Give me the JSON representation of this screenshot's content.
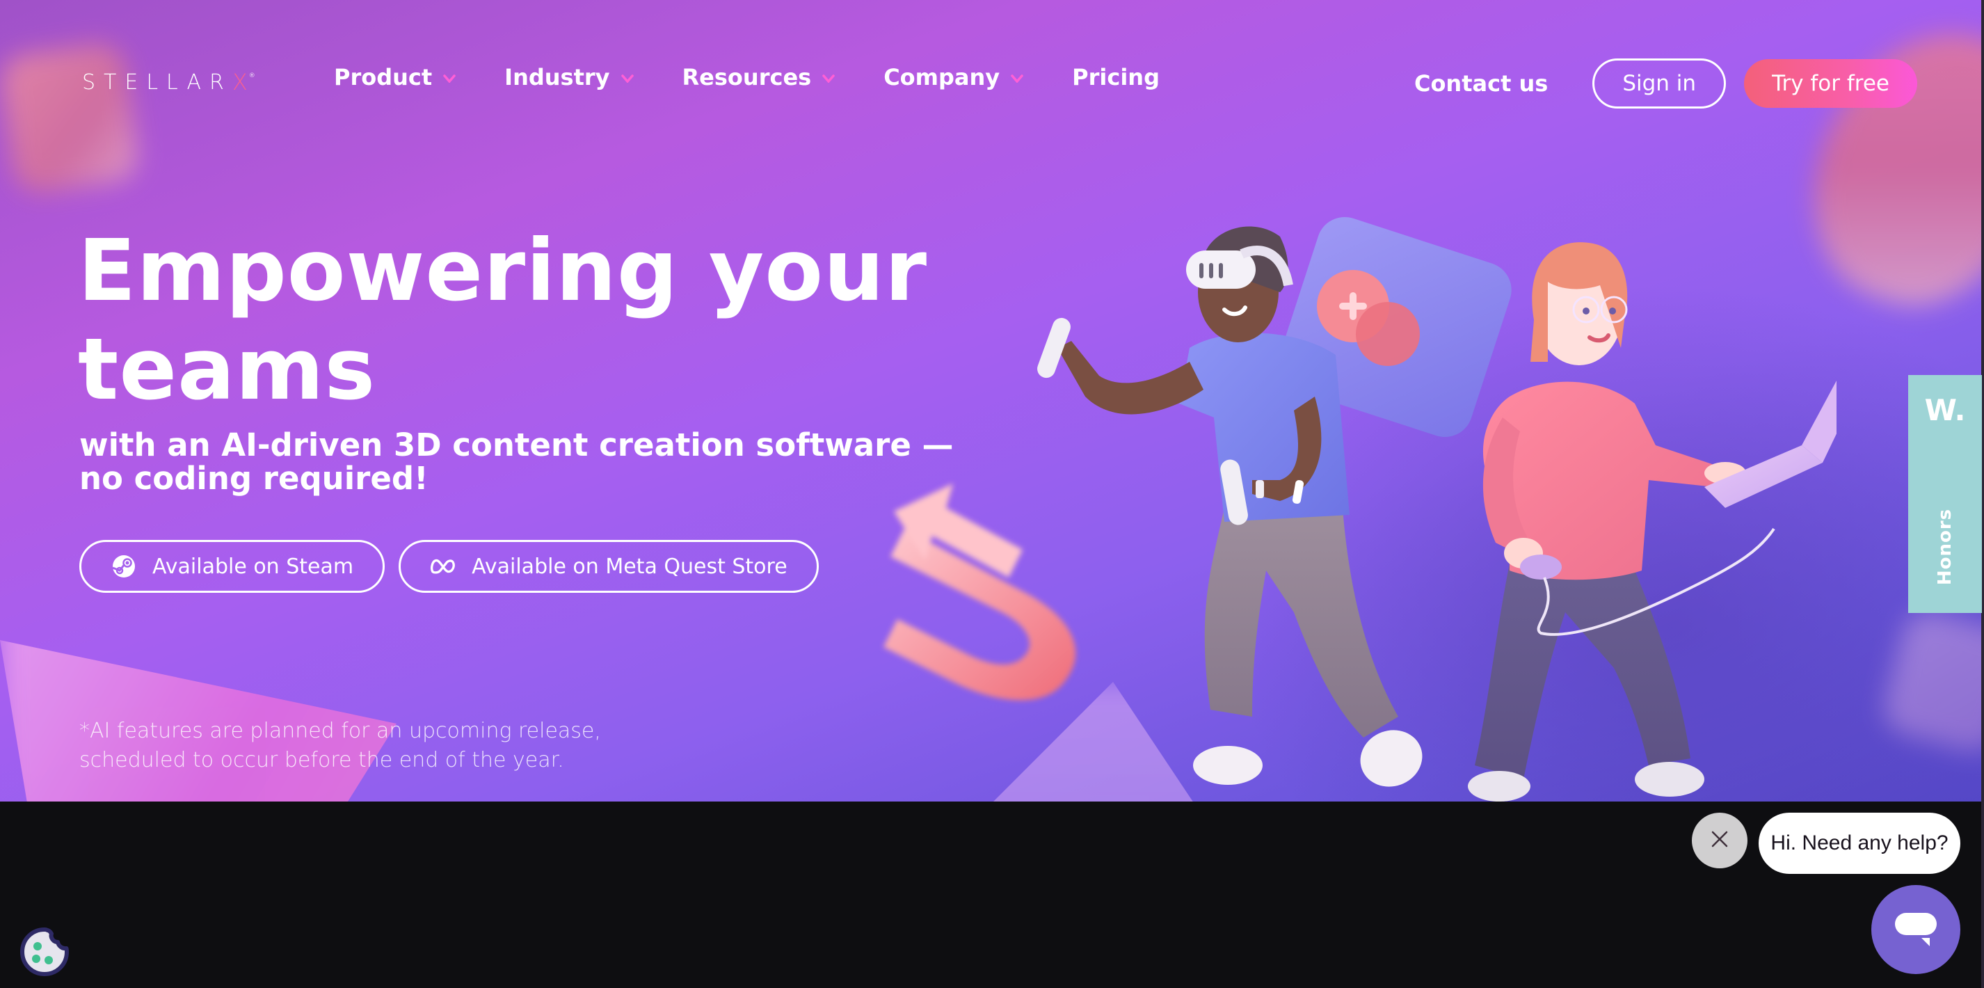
{
  "brand": {
    "logo_main": "STELLAR",
    "logo_accent": "X",
    "logo_reg": "®",
    "accent_color": "#f35f95"
  },
  "nav": {
    "items": [
      {
        "label": "Product",
        "has_dropdown": true
      },
      {
        "label": "Industry",
        "has_dropdown": true
      },
      {
        "label": "Resources",
        "has_dropdown": true
      },
      {
        "label": "Company",
        "has_dropdown": true
      },
      {
        "label": "Pricing",
        "has_dropdown": false
      }
    ],
    "contact_label": "Contact us",
    "signin_label": "Sign in",
    "try_label": "Try for free",
    "dropdown_chevron_color": "#ff5fd6"
  },
  "hero": {
    "headline_line1": "Empowering your",
    "headline_line2": "teams",
    "subhead_line1": "with an AI-driven 3D content creation software —",
    "subhead_line2": "no coding required!",
    "store_buttons": [
      {
        "label": "Available on Steam",
        "icon": "steam-icon"
      },
      {
        "label": "Available on Meta Quest Store",
        "icon": "meta-icon"
      }
    ],
    "disclaimer_line1": "*AI features are planned for an upcoming release,",
    "disclaimer_line2": "scheduled to occur before the end of the year."
  },
  "honors_badge": {
    "logo": "W.",
    "label": "Honors",
    "color": "#9ed4d6"
  },
  "chat": {
    "greeting": "Hi. Need any help?",
    "launcher_color": "#7662d1"
  },
  "cookie": {
    "icon": "cookie-icon"
  }
}
